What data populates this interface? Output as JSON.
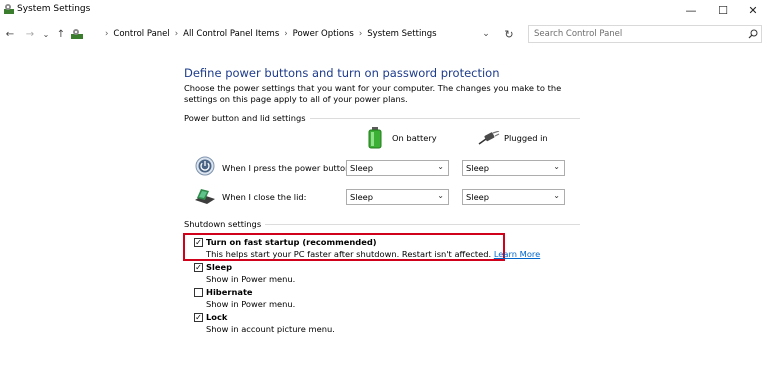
{
  "window": {
    "title": "System Settings",
    "minimize_glyph": "—",
    "maximize_glyph": "☐",
    "close_glyph": "✕"
  },
  "nav": {
    "back_glyph": "←",
    "forward_glyph": "→",
    "recent_glyph": "⌄",
    "up_glyph": "↑",
    "breadcrumb_sep": "›",
    "breadcrumbs": [
      "Control Panel",
      "All Control Panel Items",
      "Power Options",
      "System Settings"
    ],
    "dropdown_glyph": "⌄",
    "refresh_glyph": "↻",
    "search_placeholder": "Search Control Panel"
  },
  "page": {
    "heading": "Define power buttons and turn on password protection",
    "description": "Choose the power settings that you want for your computer. The changes you make to the settings on this page apply to all of your power plans."
  },
  "power_lid": {
    "group_label": "Power button and lid settings",
    "col_battery": "On battery",
    "col_plugged": "Plugged in",
    "rows": [
      {
        "label": "When I press the power button:",
        "battery": "Sleep",
        "plugged": "Sleep"
      },
      {
        "label": "When I close the lid:",
        "battery": "Sleep",
        "plugged": "Sleep"
      }
    ]
  },
  "shutdown": {
    "group_label": "Shutdown settings",
    "options": [
      {
        "title": "Turn on fast startup (recommended)",
        "desc": "This helps start your PC faster after shutdown. Restart isn't affected.",
        "link": "Learn More",
        "checked": true
      },
      {
        "title": "Sleep",
        "desc": "Show in Power menu.",
        "checked": true
      },
      {
        "title": "Hibernate",
        "desc": "Show in Power menu.",
        "checked": false
      },
      {
        "title": "Lock",
        "desc": "Show in account picture menu.",
        "checked": true
      }
    ]
  },
  "colors": {
    "heading": "#1e3c8c",
    "highlight": "#d0021b",
    "link": "#0066cc"
  },
  "icons": [
    "settings-icon",
    "control-panel-icon",
    "battery-icon",
    "plug-icon",
    "power-button-icon",
    "laptop-lid-icon"
  ]
}
